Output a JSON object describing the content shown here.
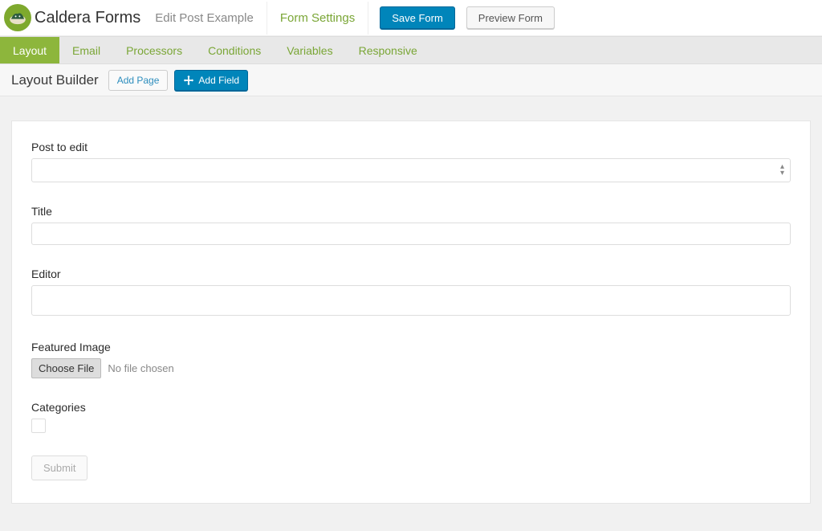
{
  "brand": "Caldera Forms",
  "subtitle": "Edit Post Example",
  "form_settings_tab": "Form Settings",
  "buttons": {
    "save": "Save Form",
    "preview": "Preview Form"
  },
  "tabs": {
    "layout": "Layout",
    "email": "Email",
    "processors": "Processors",
    "conditions": "Conditions",
    "variables": "Variables",
    "responsive": "Responsive"
  },
  "toolbar": {
    "title": "Layout Builder",
    "add_page": "Add Page",
    "add_field": "Add Field"
  },
  "form": {
    "post_to_edit": {
      "label": "Post to edit",
      "value": ""
    },
    "title": {
      "label": "Title",
      "value": ""
    },
    "editor": {
      "label": "Editor",
      "value": ""
    },
    "featured_image": {
      "label": "Featured Image",
      "button": "Choose File",
      "status": "No file chosen"
    },
    "categories": {
      "label": "Categories"
    },
    "submit": "Submit"
  }
}
